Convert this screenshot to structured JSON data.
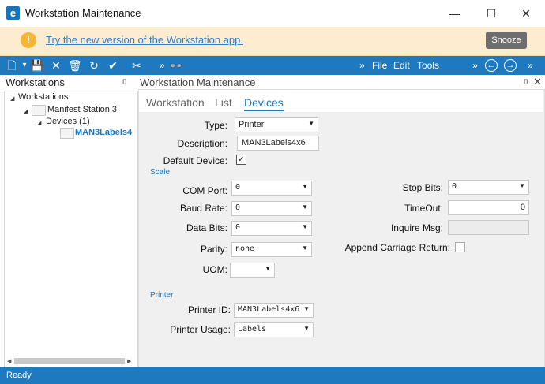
{
  "window": {
    "title": "Workstation Maintenance",
    "minimize": "—",
    "maximize": "☐",
    "close": "✕"
  },
  "banner": {
    "link_text": "Try the new version of the Workstation app.",
    "snooze_label": "Snooze",
    "warn_glyph": "!"
  },
  "toolbar": {
    "icons": {
      "new": "🗋",
      "dropdown": "▾",
      "save": "💾",
      "delete": "✕",
      "trash": "🗑",
      "refresh": "↻",
      "clear": "✔",
      "cut": "✂",
      "more": "»",
      "binoculars": "👓"
    },
    "menu": {
      "file": "File",
      "edit": "Edit",
      "tools": "Tools"
    },
    "nav": {
      "back": "←",
      "forward": "→",
      "more": "»"
    }
  },
  "left": {
    "title": "Workstations",
    "pin": "ᴨ",
    "tree": [
      {
        "label": "Workstations",
        "toggle": "◢"
      },
      {
        "label": "Manifest Station 3",
        "toggle": "◢"
      },
      {
        "label": "Devices (1)",
        "toggle": "◢"
      },
      {
        "label": "MAN3Labels4"
      }
    ],
    "scroll_left": "◀",
    "scroll_right": "▶"
  },
  "right": {
    "title": "Workstation Maintenance",
    "pin": "ᴨ",
    "close": "✕",
    "tabs": [
      "Workstation",
      "List",
      "Devices"
    ],
    "active_tab": "Devices",
    "form": {
      "type_label": "Type:",
      "type_value": "Printer",
      "description_label": "Description:",
      "description_value": "MAN3Labels4x6",
      "default_label": "Default Device:",
      "default_checked": "✓",
      "scale_section": "Scale",
      "com_port_label": "COM Port:",
      "com_port_value": "0",
      "baud_rate_label": "Baud Rate:",
      "baud_rate_value": "0",
      "data_bits_label": "Data Bits:",
      "data_bits_value": "0",
      "parity_label": "Parity:",
      "parity_value": "none",
      "uom_label": "UOM:",
      "uom_value": "",
      "stop_bits_label": "Stop Bits:",
      "stop_bits_value": "0",
      "timeout_label": "TimeOut:",
      "timeout_value": "0",
      "inquire_label": "Inquire Msg:",
      "inquire_value": "",
      "append_label": "Append Carriage Return:",
      "printer_section": "Printer",
      "printer_id_label": "Printer ID:",
      "printer_id_value": "MAN3Labels4x6",
      "printer_usage_label": "Printer Usage:",
      "printer_usage_value": "Labels",
      "arrow": "▼"
    }
  },
  "status": {
    "text": "Ready"
  },
  "colors": {
    "accent": "#1e79be",
    "banner_bg": "#fdecd0",
    "warn": "#f5b637",
    "link": "#2f7fd0"
  }
}
